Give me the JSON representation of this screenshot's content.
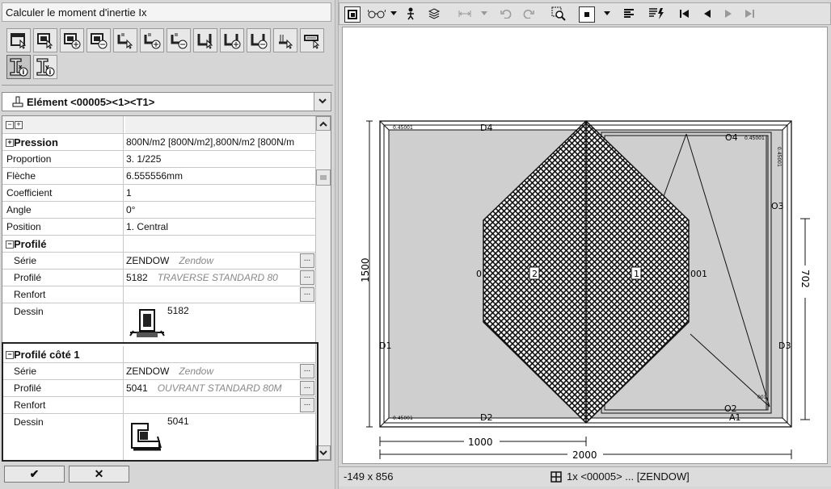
{
  "window": {
    "title": "Calculer le moment d'inertie Ix"
  },
  "toolbar_icons": [
    "select-element-icon",
    "select-profile-icon",
    "add-profile-icon",
    "remove-profile-icon",
    "select-sash-icon",
    "add-sash-icon",
    "remove-sash-icon",
    "select-frame-icon",
    "add-frame-icon",
    "remove-frame-icon",
    "select-mullion-icon",
    "select-transom-icon"
  ],
  "info_buttons": [
    {
      "icon": "inertia-ix-info-icon",
      "selected": true
    },
    {
      "icon": "inertia-iy-info-icon",
      "selected": false
    }
  ],
  "element_selector": {
    "value": "Elément <00005><1><T1>"
  },
  "properties": {
    "pression": {
      "label": "Pression",
      "value": "800N/m2 [800N/m2],800N/m2 [800N/m"
    },
    "proportion": {
      "label": "Proportion",
      "value": "3. 1/225"
    },
    "fleche": {
      "label": "Flèche",
      "value": "6.555556mm"
    },
    "coefficient": {
      "label": "Coefficient",
      "value": "1"
    },
    "angle": {
      "label": "Angle",
      "value": "0°"
    },
    "position": {
      "label": "Position",
      "value": "1. Central"
    },
    "profile_group": {
      "label": "Profilé",
      "serie": {
        "label": "Série",
        "value": "ZENDOW",
        "hint": "Zendow"
      },
      "profile": {
        "label": "Profilé",
        "value": "5182",
        "hint": "TRAVERSE STANDARD 80"
      },
      "renfort": {
        "label": "Renfort",
        "value": ""
      },
      "dessin": {
        "label": "Dessin",
        "value": "5182"
      }
    },
    "profile_side1_group": {
      "label": "Profilé côté 1",
      "serie": {
        "label": "Série",
        "value": "ZENDOW",
        "hint": "Zendow"
      },
      "profile": {
        "label": "Profilé",
        "value": "5041",
        "hint": "OUVRANT STANDARD 80M"
      },
      "renfort": {
        "label": "Renfort",
        "value": ""
      },
      "dessin": {
        "label": "Dessin",
        "value": "5041"
      }
    }
  },
  "buttons": {
    "ok": "✔",
    "cancel": "✕"
  },
  "drawing": {
    "labels": {
      "d4": "D4",
      "d2": "D2",
      "d1": "D1",
      "d3": "D3",
      "o4": "O4",
      "o3": "O3",
      "o2": "O2",
      "a1": "A1",
      "zero": "0",
      "mark_2": "2",
      "mark_1": "1",
      "code_001": "001",
      "tag_tl": "0.45001",
      "tag_tr": "0.45001",
      "tag_r": "0.45001",
      "tag_bl": "0.45001",
      "tag_br": "001"
    },
    "dimensions": {
      "height": "1500",
      "width_half": "1000",
      "width": "2000",
      "right_height": "702"
    }
  },
  "status": {
    "coords": "-149 x 856",
    "selection": "1x <00005> ... [ZENDOW]"
  }
}
